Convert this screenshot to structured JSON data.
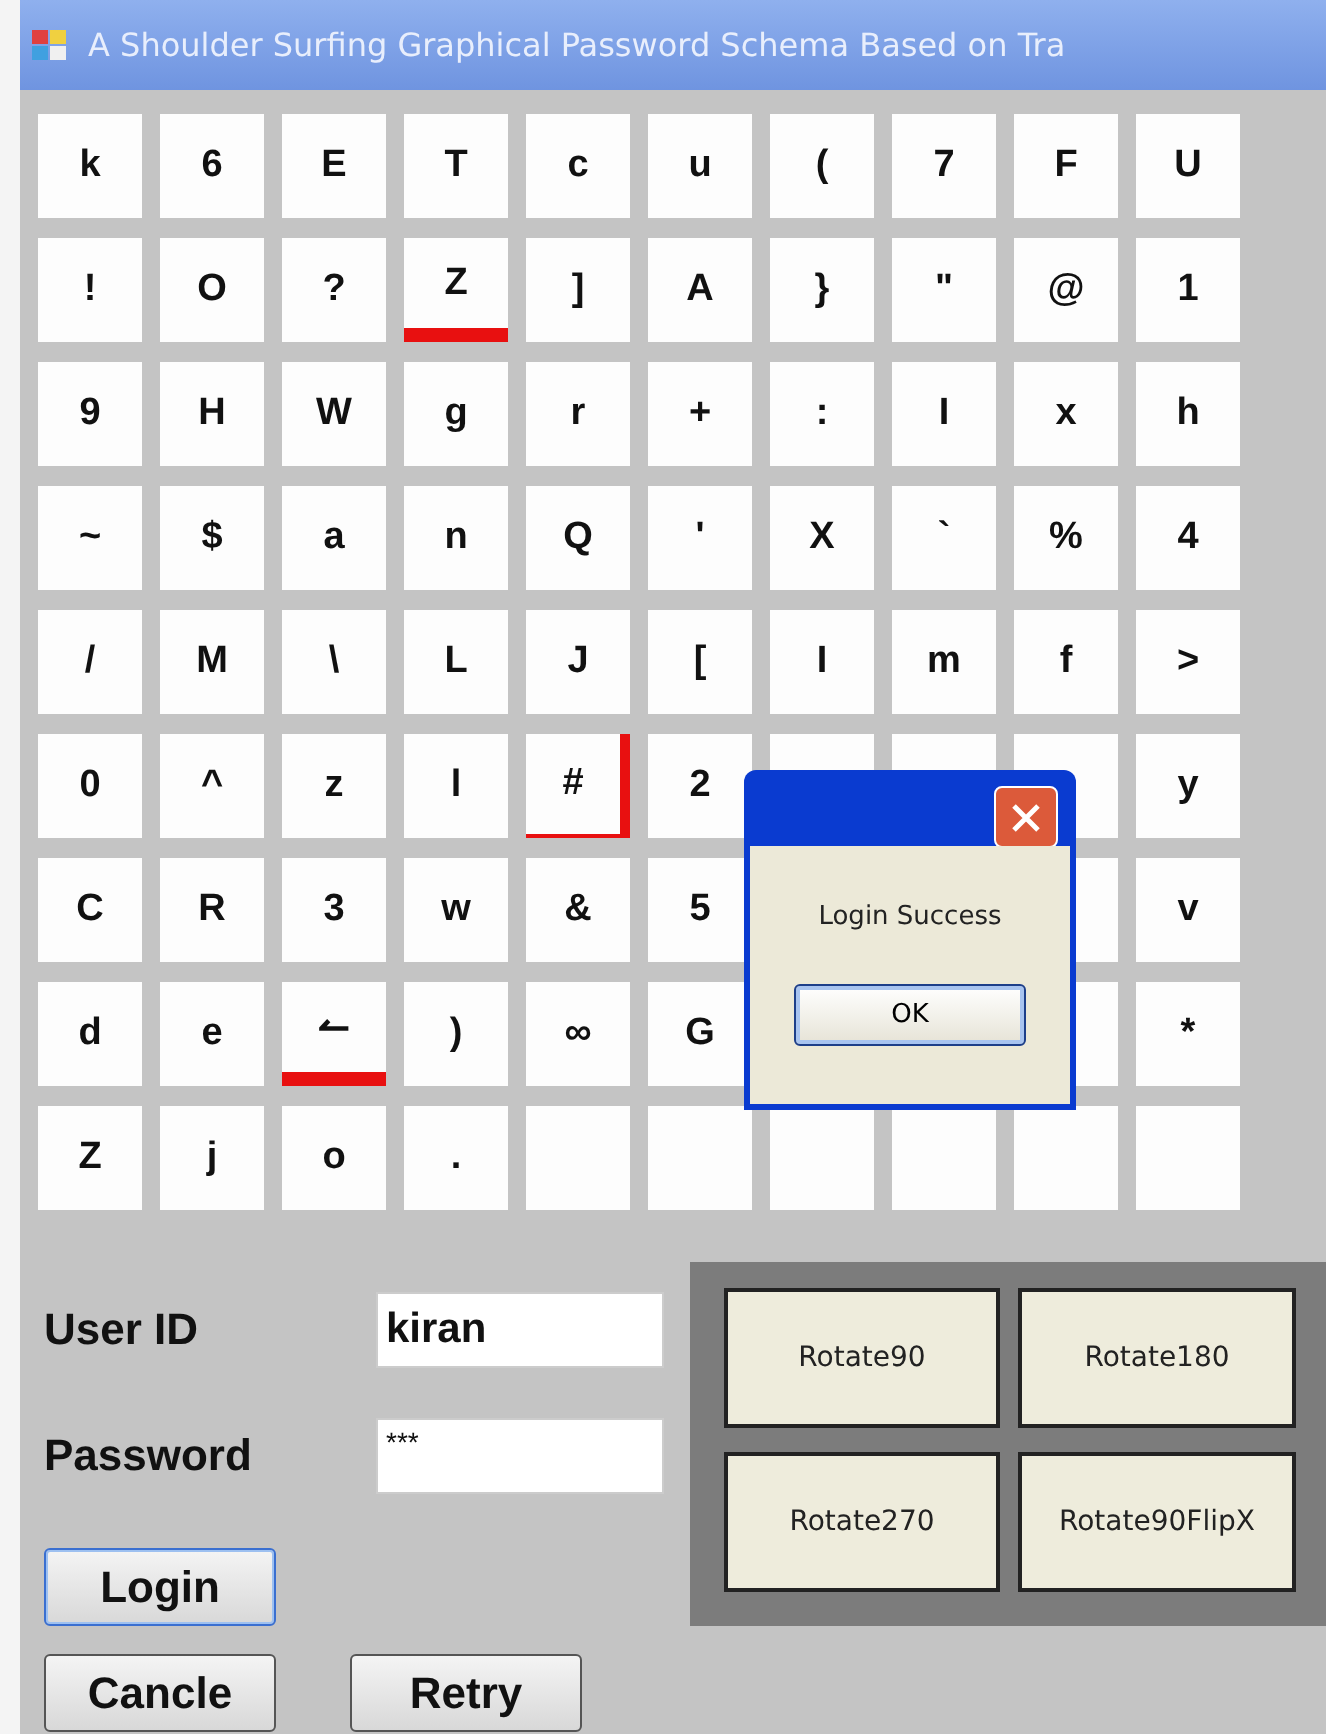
{
  "window": {
    "title": "A Shoulder Surfing Graphical Password Schema Based on Tra"
  },
  "grid": [
    {
      "cells": [
        {
          "kind": "key",
          "text": "k"
        },
        {
          "kind": "key",
          "text": "6"
        },
        {
          "kind": "key",
          "text": "E"
        },
        {
          "kind": "key",
          "text": "T"
        },
        {
          "kind": "key",
          "text": "c"
        },
        {
          "kind": "key",
          "text": "u"
        },
        {
          "kind": "key",
          "text": "("
        },
        {
          "kind": "key",
          "text": "7"
        },
        {
          "kind": "key",
          "text": "F"
        },
        {
          "kind": "key",
          "text": "U"
        }
      ]
    },
    {
      "cells": [
        {
          "kind": "key",
          "text": "!"
        },
        {
          "kind": "key",
          "text": "O"
        },
        {
          "kind": "key",
          "text": "?"
        },
        {
          "kind": "key",
          "text": "Z",
          "underlined": true
        },
        {
          "kind": "key",
          "text": "]"
        },
        {
          "kind": "key",
          "text": "A"
        },
        {
          "kind": "key",
          "text": "}"
        },
        {
          "kind": "key",
          "text": "\""
        },
        {
          "kind": "key",
          "text": "@"
        },
        {
          "kind": "key",
          "text": "1"
        }
      ]
    },
    {
      "cells": [
        {
          "kind": "key",
          "text": "9"
        },
        {
          "kind": "key",
          "text": "H"
        },
        {
          "kind": "key",
          "text": "W"
        },
        {
          "kind": "key",
          "text": "g"
        },
        {
          "kind": "key",
          "text": "r"
        },
        {
          "kind": "key",
          "text": "+"
        },
        {
          "kind": "key",
          "text": ":"
        },
        {
          "kind": "key",
          "text": "I"
        },
        {
          "kind": "key",
          "text": "x"
        },
        {
          "kind": "key",
          "text": "h"
        }
      ]
    },
    {
      "cells": [
        {
          "kind": "key",
          "text": "~"
        },
        {
          "kind": "key",
          "text": "$"
        },
        {
          "kind": "key",
          "text": "a"
        },
        {
          "kind": "key",
          "text": "n"
        },
        {
          "kind": "key",
          "text": "Q"
        },
        {
          "kind": "key",
          "text": "'"
        },
        {
          "kind": "key",
          "text": "X"
        },
        {
          "kind": "key",
          "text": "`"
        },
        {
          "kind": "key",
          "text": "%"
        },
        {
          "kind": "key",
          "text": "4"
        }
      ]
    },
    {
      "cells": [
        {
          "kind": "key",
          "text": "/"
        },
        {
          "kind": "key",
          "text": "M"
        },
        {
          "kind": "key",
          "text": "\\"
        },
        {
          "kind": "key",
          "text": "L"
        },
        {
          "kind": "key",
          "text": "J"
        },
        {
          "kind": "key",
          "text": "["
        },
        {
          "kind": "key",
          "text": "I"
        },
        {
          "kind": "key",
          "text": "m"
        },
        {
          "kind": "key",
          "text": "f"
        },
        {
          "kind": "key",
          "text": ">"
        }
      ]
    },
    {
      "cells": [
        {
          "kind": "key",
          "text": "0"
        },
        {
          "kind": "key",
          "text": "^"
        },
        {
          "kind": "key",
          "text": "z"
        },
        {
          "kind": "key",
          "text": "l"
        },
        {
          "kind": "key",
          "text": "#",
          "side_bar": true
        },
        {
          "kind": "key",
          "text": "2"
        },
        {
          "kind": "blank"
        },
        {
          "kind": "blank"
        },
        {
          "kind": "blank"
        },
        {
          "kind": "key",
          "text": "y"
        }
      ]
    },
    {
      "cells": [
        {
          "kind": "key",
          "text": "C"
        },
        {
          "kind": "key",
          "text": "R"
        },
        {
          "kind": "key",
          "text": "3"
        },
        {
          "kind": "key",
          "text": "w"
        },
        {
          "kind": "key",
          "text": "&"
        },
        {
          "kind": "key",
          "text": "5"
        }
      ],
      "end_cells": [
        {
          "kind": "blank"
        },
        {
          "kind": "key",
          "text": "v"
        }
      ]
    },
    {
      "cells": [
        {
          "kind": "key",
          "text": "d"
        },
        {
          "kind": "key",
          "text": "e"
        },
        {
          "kind": "key",
          "text": "↼",
          "underlined": true
        },
        {
          "kind": "key",
          "text": ")"
        },
        {
          "kind": "key",
          "text": "∞"
        },
        {
          "kind": "key",
          "text": "G"
        }
      ],
      "end_cells": [
        {
          "kind": "blank"
        },
        {
          "kind": "key",
          "text": "*"
        }
      ]
    },
    {
      "cells": [
        {
          "kind": "key",
          "text": "Z"
        },
        {
          "kind": "key",
          "text": "j"
        },
        {
          "kind": "key",
          "text": "o"
        },
        {
          "kind": "key",
          "text": "."
        },
        {
          "kind": "blank"
        },
        {
          "kind": "blank"
        },
        {
          "kind": "blank"
        },
        {
          "kind": "blank"
        },
        {
          "kind": "blank"
        },
        {
          "kind": "blank"
        }
      ]
    }
  ],
  "form": {
    "user_id_label": "User ID",
    "user_id_value": "kiran",
    "password_label": "Password",
    "password_value": "***"
  },
  "buttons": [
    "Login",
    "Cancle",
    "Retry"
  ],
  "rotate_buttons": [
    "Rotate90",
    "Rotate180",
    "Rotate270",
    "Rotate90FlipX"
  ],
  "dialog": {
    "message": "Login Success",
    "ok": "OK"
  }
}
